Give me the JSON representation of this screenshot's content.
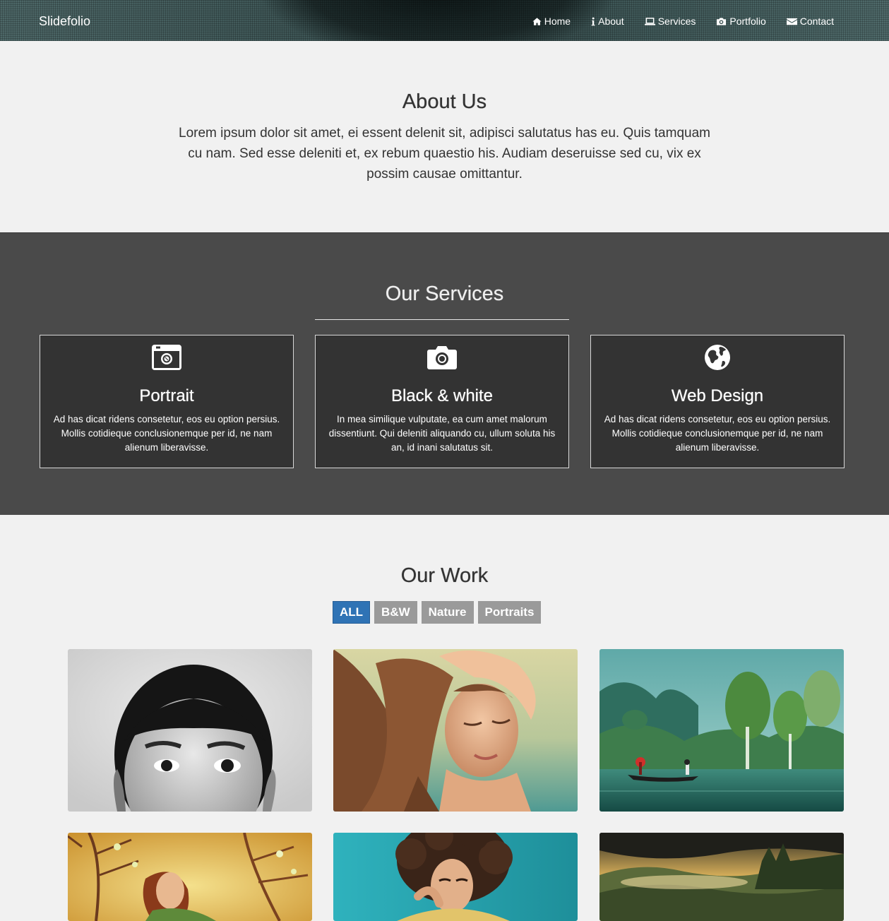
{
  "nav": {
    "brand": "Slidefolio",
    "links": [
      {
        "label": "Home",
        "icon": "home-icon"
      },
      {
        "label": "About",
        "icon": "info-icon"
      },
      {
        "label": "Services",
        "icon": "laptop-icon"
      },
      {
        "label": "Portfolio",
        "icon": "camera-icon"
      },
      {
        "label": "Contact",
        "icon": "envelope-icon"
      }
    ]
  },
  "about": {
    "title": "About Us",
    "text": "Lorem ipsum dolor sit amet, ei essent delenit sit, adipisci salutatus has eu. Quis tamquam cu nam. Sed esse deleniti et, ex rebum quaestio his. Audiam deseruisse sed cu, vix ex possim causae omittantur."
  },
  "services": {
    "title": "Our Services",
    "items": [
      {
        "title": "Portrait",
        "icon": "instagram-camera-icon",
        "text": "Ad has dicat ridens consetetur, eos eu option persius. Mollis cotidieque conclusionemque per id, ne nam alienum liberavisse."
      },
      {
        "title": "Black & white",
        "icon": "camera-icon",
        "text": "In mea similique vulputate, ea cum amet malorum dissentiunt. Qui deleniti aliquando cu, ullum soluta his an, id inani salutatus sit."
      },
      {
        "title": "Web Design",
        "icon": "globe-icon",
        "text": "Ad has dicat ridens consetetur, eos eu option persius. Mollis cotidieque conclusionemque per id, ne nam alienum liberavisse."
      }
    ]
  },
  "work": {
    "title": "Our Work",
    "filters": [
      {
        "label": "ALL",
        "active": true
      },
      {
        "label": "B&W",
        "active": false
      },
      {
        "label": "Nature",
        "active": false
      },
      {
        "label": "Portraits",
        "active": false
      }
    ],
    "tiles": [
      "bw-portrait-photo",
      "woman-hair-photo",
      "lake-boat-photo",
      "woman-blossoms-photo",
      "woman-curly-hair-photo",
      "misty-forest-photo"
    ]
  },
  "colors": {
    "services_bg": "#4a4a4a",
    "card_bg": "#333333",
    "active_filter": "#2f73b5",
    "inactive_filter": "#9a9a9a",
    "page_bg": "#f1f1f1"
  }
}
